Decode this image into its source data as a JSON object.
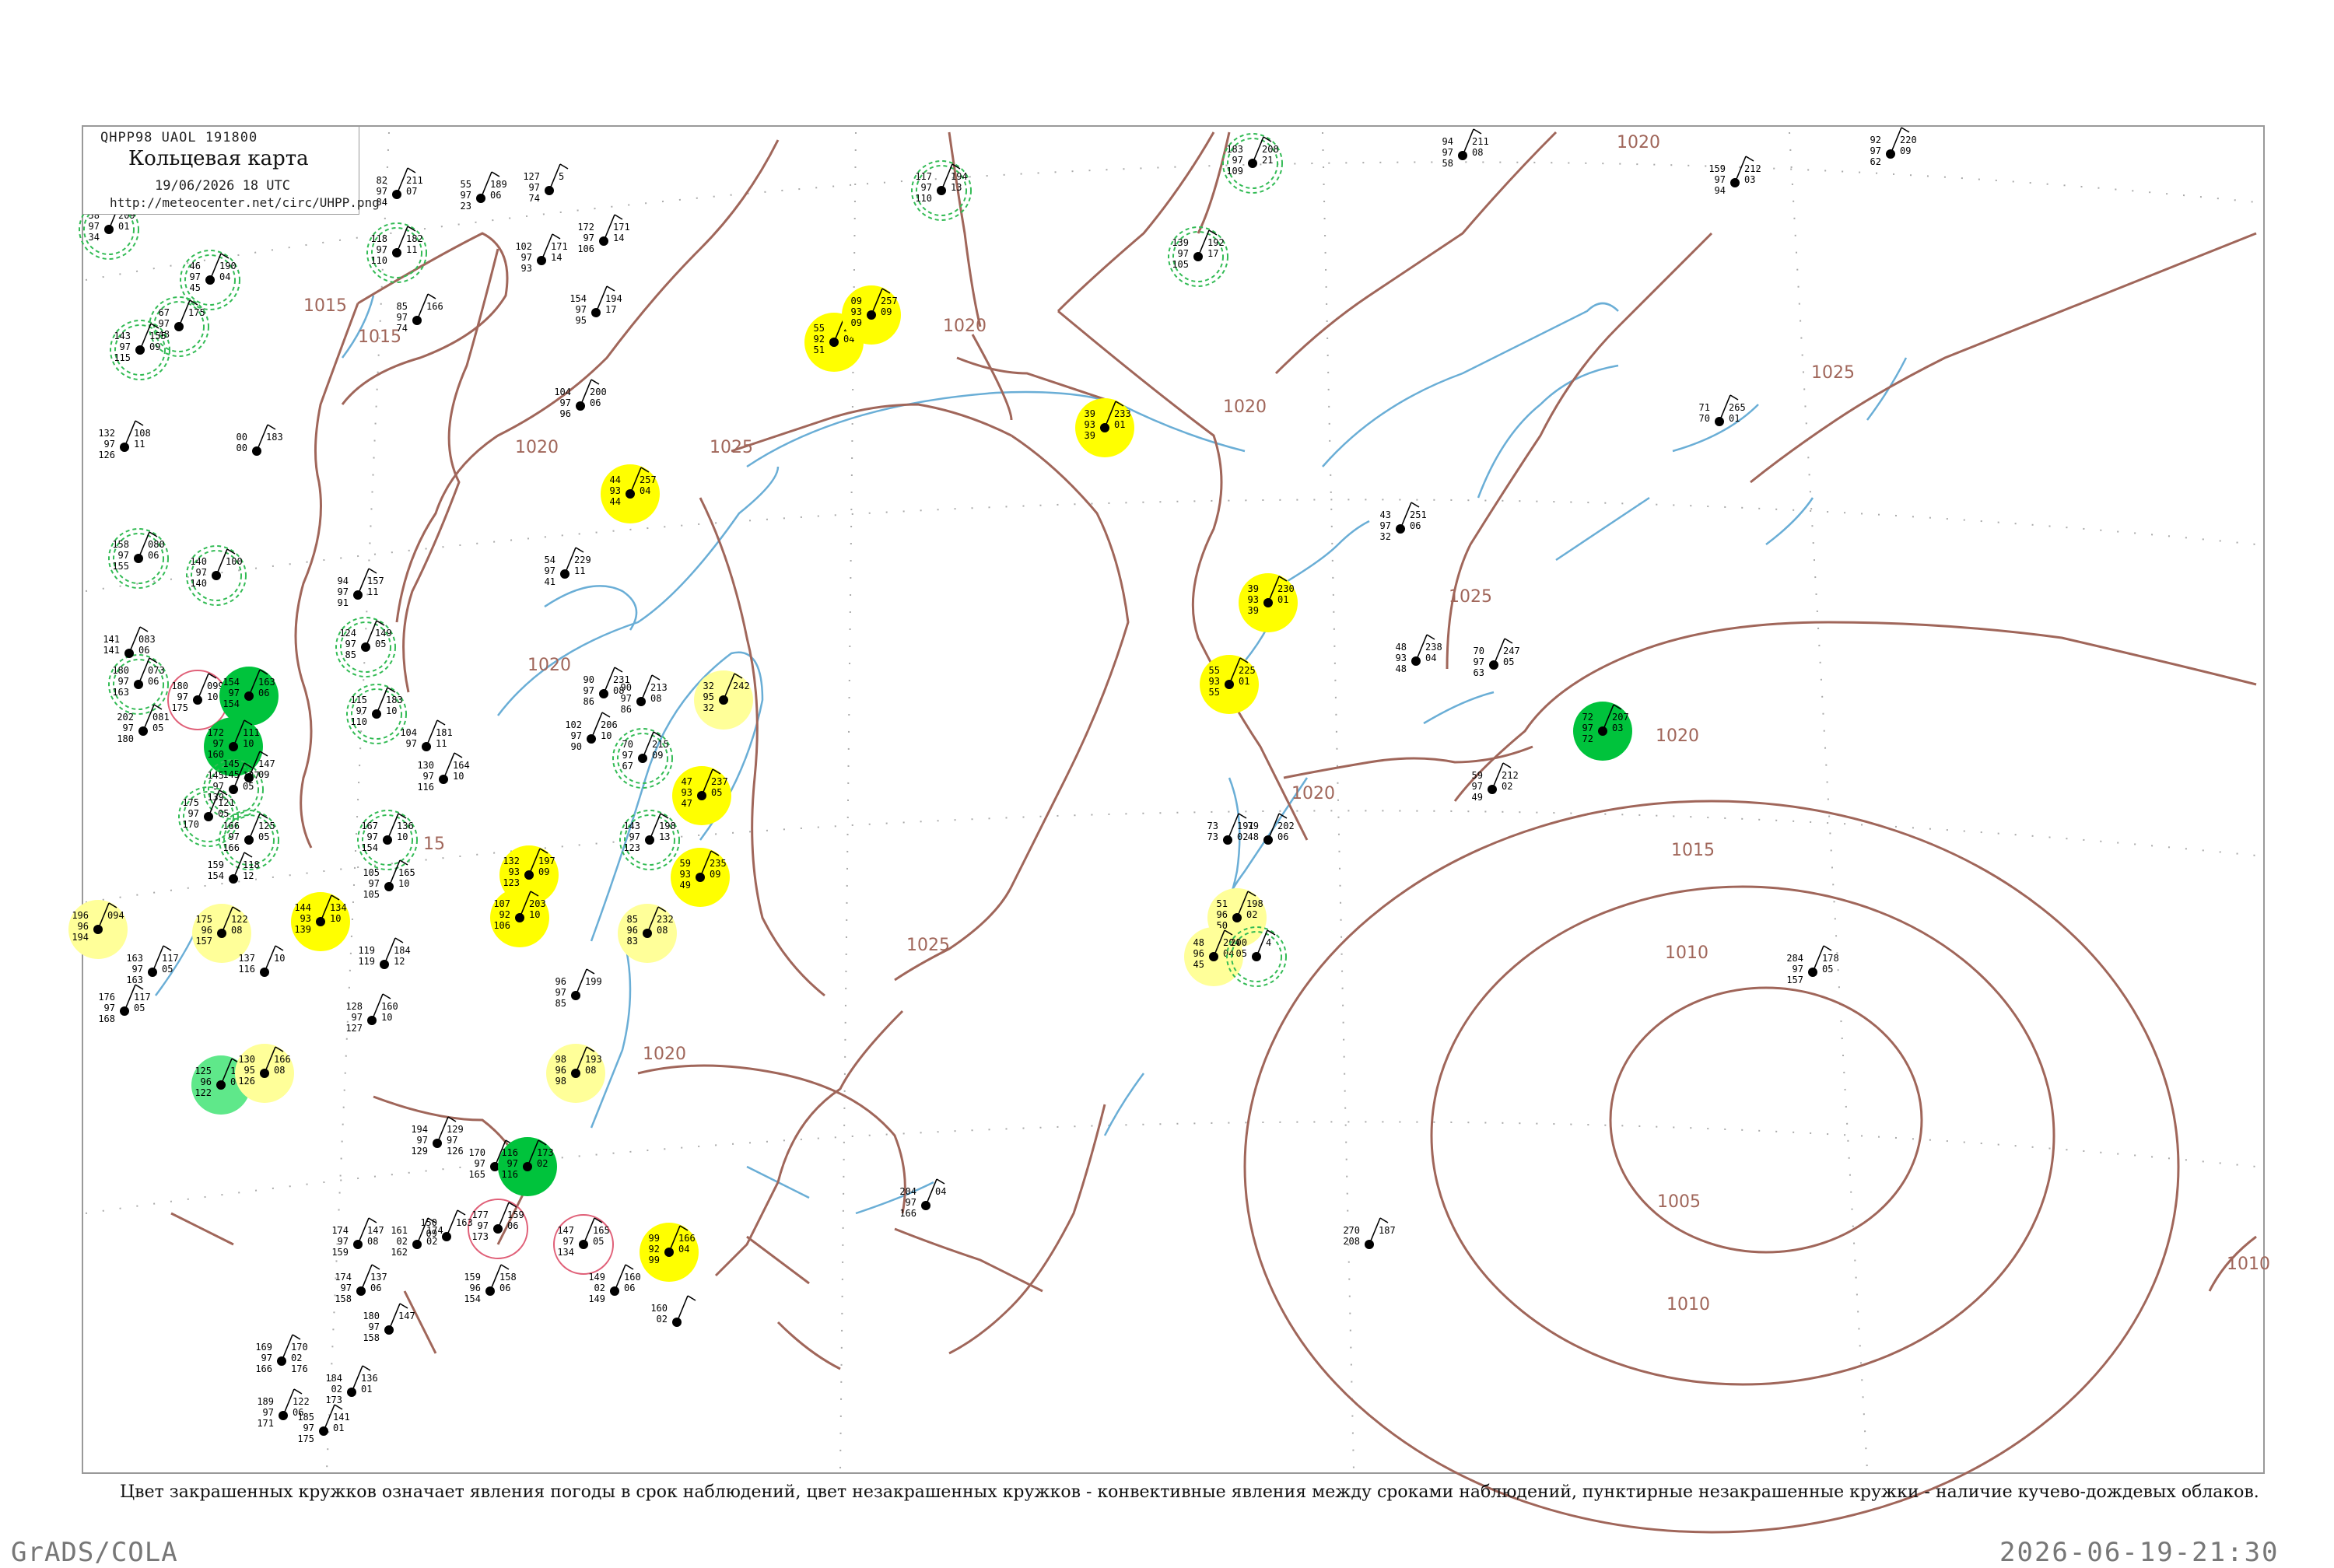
{
  "header": {
    "code": "QHPP98  UAOL  191800",
    "name": "Кольцевая карта",
    "time": "19/06/2026 18 UTC",
    "url": "http://meteocenter.net/circ/UHPP.png"
  },
  "caption": "Цвет закрашенных кружков означает явления погоды в срок наблюдений, цвет незакрашенных кружков - конвективные явления между сроками наблюдений, пунктирные незакрашенные кружки - наличие кучево-дождевых облаков.",
  "footer": {
    "left": "GrADS/COLA",
    "right": "2026-06-19-21:30"
  },
  "colors": {
    "isobar": "#a0665a",
    "water": "#6aaed6",
    "yellow": "#ffff00",
    "light_yellow": "#ffff99",
    "green": "#00c33c",
    "light_green": "#5fe88a",
    "red": "#f03c5a",
    "dashed_green": "#33bb55",
    "outline_red": "#e06078"
  },
  "isobar_labels": [
    {
      "text": "1015"
    },
    {
      "text": "1015"
    },
    {
      "text": "1020"
    },
    {
      "text": "1025"
    },
    {
      "text": "1020"
    },
    {
      "text": "1020"
    },
    {
      "text": "1020"
    },
    {
      "text": "1025"
    },
    {
      "text": "1025"
    },
    {
      "text": "1020"
    },
    {
      "text": "1020"
    },
    {
      "text": "1015"
    },
    {
      "text": "1010"
    },
    {
      "text": "1005"
    },
    {
      "text": "1010"
    },
    {
      "text": "1020"
    },
    {
      "text": "1020"
    },
    {
      "text": "1025"
    },
    {
      "text": "15"
    },
    {
      "text": "1010"
    }
  ],
  "stations": [
    {
      "lines": [
        "82",
        "97",
        "84"
      ],
      "right": [
        "211",
        "07"
      ]
    },
    {
      "lines": [
        "118",
        "97",
        "110"
      ],
      "right": [
        "182",
        "11"
      ]
    },
    {
      "lines": [
        "55",
        "97",
        "23"
      ],
      "right": [
        "189",
        "06"
      ]
    },
    {
      "lines": [
        "127",
        "97",
        "74"
      ],
      "right": [
        "5"
      ]
    },
    {
      "lines": [
        "102",
        "97",
        "93"
      ],
      "right": [
        "171",
        "14"
      ]
    },
    {
      "lines": [
        "172",
        "97",
        "106"
      ],
      "right": [
        "171",
        "14"
      ]
    },
    {
      "lines": [
        "154",
        "97",
        "95"
      ],
      "right": [
        "194",
        "17"
      ]
    },
    {
      "lines": [
        "104",
        "97",
        "96"
      ],
      "right": [
        "200",
        "06"
      ]
    },
    {
      "lines": [
        "85",
        "97",
        "74"
      ],
      "right": [
        "166"
      ]
    },
    {
      "lines": [
        "117",
        "97",
        "110"
      ],
      "right": [
        "194",
        "13"
      ]
    },
    {
      "lines": [
        "183",
        "97",
        "109"
      ],
      "right": [
        "208",
        "21"
      ]
    },
    {
      "lines": [
        "139",
        "97",
        "105"
      ],
      "right": [
        "192",
        "17"
      ]
    },
    {
      "lines": [
        "94",
        "97",
        "58"
      ],
      "right": [
        "211",
        "08"
      ]
    },
    {
      "lines": [
        "159",
        "97",
        "94"
      ],
      "right": [
        "212",
        "03"
      ]
    },
    {
      "lines": [
        "92",
        "97",
        "62"
      ],
      "right": [
        "220",
        "09"
      ]
    },
    {
      "lines": [
        "58",
        "97",
        "34"
      ],
      "right": [
        "209",
        "01"
      ]
    },
    {
      "lines": [
        "46",
        "97",
        "45"
      ],
      "right": [
        "190",
        "04"
      ]
    },
    {
      "lines": [
        "67",
        "97",
        "48"
      ],
      "right": [
        "175"
      ]
    },
    {
      "lines": [
        "143",
        "97",
        "115"
      ],
      "right": [
        "155",
        "09"
      ]
    },
    {
      "lines": [
        "132",
        "97",
        "126"
      ],
      "right": [
        "108",
        "11"
      ]
    },
    {
      "lines": [
        "158",
        "97",
        "155"
      ],
      "right": [
        "080",
        "06"
      ]
    },
    {
      "lines": [
        "140",
        "97",
        "140"
      ],
      "right": [
        "100"
      ]
    },
    {
      "lines": [
        "94",
        "97",
        "91"
      ],
      "right": [
        "157",
        "11"
      ]
    },
    {
      "lines": [
        "124",
        "97",
        "85"
      ],
      "right": [
        "149",
        "05"
      ]
    },
    {
      "lines": [
        "54",
        "97",
        "41"
      ],
      "right": [
        "229",
        "11"
      ]
    },
    {
      "lines": [
        "43",
        "97",
        "32"
      ],
      "right": [
        "251",
        "06"
      ]
    },
    {
      "lines": [
        "71",
        "70"
      ],
      "right": [
        "265",
        "01"
      ]
    },
    {
      "lines": [
        "39",
        "93",
        "39"
      ],
      "right": [
        "233",
        "01"
      ]
    },
    {
      "lines": [
        "44",
        "93",
        "44"
      ],
      "right": [
        "257",
        "04"
      ]
    },
    {
      "lines": [
        "55",
        "92",
        "51"
      ],
      "right": [
        "244",
        "04"
      ]
    },
    {
      "lines": [
        "09",
        "93",
        "09"
      ],
      "right": [
        "257",
        "09"
      ]
    },
    {
      "lines": [
        "39",
        "93",
        "39"
      ],
      "right": [
        "230",
        "01"
      ]
    },
    {
      "lines": [
        "55",
        "93",
        "55"
      ],
      "right": [
        "225",
        "01"
      ]
    },
    {
      "lines": [
        "48",
        "93",
        "48"
      ],
      "right": [
        "238",
        "04"
      ]
    },
    {
      "lines": [
        "70",
        "97",
        "63"
      ],
      "right": [
        "247",
        "05"
      ]
    },
    {
      "lines": [
        "59",
        "97",
        "49"
      ],
      "right": [
        "212",
        "02"
      ]
    },
    {
      "lines": [
        "72",
        "97",
        "72"
      ],
      "right": [
        "207",
        "03"
      ]
    },
    {
      "lines": [
        "180",
        "97",
        "163"
      ],
      "right": [
        "073",
        "06"
      ]
    },
    {
      "lines": [
        "180",
        "97",
        "175"
      ],
      "right": [
        "099",
        "10"
      ]
    },
    {
      "lines": [
        "154",
        "97",
        "154"
      ],
      "right": [
        "163",
        "06"
      ]
    },
    {
      "lines": [
        "202",
        "97",
        "180"
      ],
      "right": [
        "081",
        "05"
      ]
    },
    {
      "lines": [
        "172",
        "97",
        "160"
      ],
      "right": [
        "111",
        "10"
      ]
    },
    {
      "lines": [
        "115",
        "97",
        "110"
      ],
      "right": [
        "183",
        "10"
      ]
    },
    {
      "lines": [
        "90",
        "97",
        "86"
      ],
      "right": [
        "231",
        "08"
      ]
    },
    {
      "lines": [
        "90",
        "97",
        "86"
      ],
      "right": [
        "213",
        "08"
      ]
    },
    {
      "lines": [
        "104",
        "97",
        ""
      ],
      "right": [
        "181",
        "11"
      ]
    },
    {
      "lines": [
        "130",
        "97",
        "116"
      ],
      "right": [
        "164",
        "10"
      ]
    },
    {
      "lines": [
        "102",
        "97",
        "90"
      ],
      "right": [
        "206",
        "10"
      ]
    },
    {
      "lines": [
        "70",
        "97",
        "67"
      ],
      "right": [
        "215",
        "09"
      ]
    },
    {
      "lines": [
        "32",
        "95",
        "32"
      ],
      "right": [
        "242"
      ]
    },
    {
      "lines": [
        "47",
        "93",
        "47"
      ],
      "right": [
        "237",
        "05"
      ]
    },
    {
      "lines": [
        "145",
        "97",
        "139"
      ],
      "right": [
        "127",
        "05"
      ]
    },
    {
      "lines": [
        "175",
        "97",
        "170"
      ],
      "right": [
        "121",
        "05"
      ]
    },
    {
      "lines": [
        "166",
        "97",
        "166"
      ],
      "right": [
        "125",
        "05"
      ]
    },
    {
      "lines": [
        "167",
        "97",
        "154"
      ],
      "right": [
        "136",
        "10"
      ]
    },
    {
      "lines": [
        "105",
        "97",
        "105"
      ],
      "right": [
        "165",
        "10"
      ]
    },
    {
      "lines": [
        "143",
        "97",
        "123"
      ],
      "right": [
        "198",
        "13"
      ]
    },
    {
      "lines": [
        "132",
        "93",
        "123"
      ],
      "right": [
        "197",
        "09"
      ]
    },
    {
      "lines": [
        "107",
        "92",
        "106"
      ],
      "right": [
        "203",
        "10"
      ]
    },
    {
      "lines": [
        "59",
        "93",
        "49"
      ],
      "right": [
        "235",
        "09"
      ]
    },
    {
      "lines": [
        "196",
        "96",
        "194"
      ],
      "right": [
        "094"
      ]
    },
    {
      "lines": [
        "175",
        "96",
        "157"
      ],
      "right": [
        "122",
        "08"
      ]
    },
    {
      "lines": [
        "144",
        "93",
        "139"
      ],
      "right": [
        "134",
        "10"
      ]
    },
    {
      "lines": [
        "163",
        "97",
        "163"
      ],
      "right": [
        "117",
        "05"
      ]
    },
    {
      "lines": [
        "176",
        "97",
        "168"
      ],
      "right": [
        "117",
        "05"
      ]
    },
    {
      "lines": [
        "137",
        "116"
      ],
      "right": [
        "10"
      ]
    },
    {
      "lines": [
        "128",
        "97",
        "127"
      ],
      "right": [
        "160",
        "10"
      ]
    },
    {
      "lines": [
        "119",
        "119"
      ],
      "right": [
        "184",
        "12"
      ]
    },
    {
      "lines": [
        "96",
        "97",
        "85"
      ],
      "right": [
        "199"
      ]
    },
    {
      "lines": [
        "85",
        "96",
        "83"
      ],
      "right": [
        "232",
        "08"
      ]
    },
    {
      "lines": [
        "98",
        "96",
        "98"
      ],
      "right": [
        "193",
        "08"
      ]
    },
    {
      "lines": [
        "51",
        "96",
        "50"
      ],
      "right": [
        "198",
        "02"
      ]
    },
    {
      "lines": [
        "48",
        "96",
        "45"
      ],
      "right": [
        "204",
        "04"
      ]
    },
    {
      "lines": [
        "200",
        "05"
      ],
      "right": [
        "4"
      ]
    },
    {
      "lines": [
        "73",
        "73"
      ],
      "right": [
        "191",
        "02"
      ]
    },
    {
      "lines": [
        "79",
        "48"
      ],
      "right": [
        "202",
        "06"
      ]
    },
    {
      "lines": [
        "284",
        "97",
        "157"
      ],
      "right": [
        "178",
        "05"
      ]
    },
    {
      "lines": [
        "125",
        "96",
        "122"
      ],
      "right": [
        "150",
        "04"
      ]
    },
    {
      "lines": [
        "130",
        "95",
        "126"
      ],
      "right": [
        "166",
        "08"
      ]
    },
    {
      "lines": [
        "194",
        "97",
        "129"
      ],
      "right": [
        "129",
        "97",
        "126"
      ]
    },
    {
      "lines": [
        "170",
        "97",
        "165"
      ],
      "right": [
        "156",
        "08"
      ]
    },
    {
      "lines": [
        "116",
        "97",
        "116"
      ],
      "right": [
        "173",
        "02"
      ]
    },
    {
      "lines": [
        "177",
        "97",
        "173"
      ],
      "right": [
        "159",
        "06"
      ]
    },
    {
      "lines": [
        "147",
        "97",
        "134"
      ],
      "right": [
        "165",
        "05"
      ]
    },
    {
      "lines": [
        "99",
        "92",
        "99"
      ],
      "right": [
        "166",
        "04"
      ]
    },
    {
      "lines": [
        "204",
        "97",
        "166"
      ],
      "right": [
        "04"
      ]
    },
    {
      "lines": [
        "270",
        "208"
      ],
      "right": [
        "187"
      ]
    },
    {
      "lines": [
        "174",
        "97",
        "159"
      ],
      "right": [
        "147",
        "08"
      ]
    },
    {
      "lines": [
        "174",
        "97",
        "158"
      ],
      "right": [
        "137",
        "06"
      ]
    },
    {
      "lines": [
        "180",
        "97",
        "158"
      ],
      "right": [
        "147"
      ]
    },
    {
      "lines": [
        "161",
        "02",
        "162"
      ],
      "right": [
        "174",
        "02"
      ]
    },
    {
      "lines": [
        "150",
        "09"
      ],
      "right": [
        "163"
      ]
    },
    {
      "lines": [
        "159",
        "96",
        "154"
      ],
      "right": [
        "158",
        "06"
      ]
    },
    {
      "lines": [
        "149",
        "02",
        "149"
      ],
      "right": [
        "160",
        "06"
      ]
    },
    {
      "lines": [
        "160",
        "02"
      ],
      "right": [
        ""
      ]
    },
    {
      "lines": [
        "169",
        "97",
        "166"
      ],
      "right": [
        "170",
        "02",
        "176"
      ]
    },
    {
      "lines": [
        "189",
        "97",
        "171"
      ],
      "right": [
        "122",
        "06"
      ]
    },
    {
      "lines": [
        "184",
        "02",
        "173"
      ],
      "right": [
        "136",
        "01"
      ]
    },
    {
      "lines": [
        "185",
        "97",
        "175"
      ],
      "right": [
        "141",
        "01"
      ]
    },
    {
      "lines": [
        "141",
        "141"
      ],
      "right": [
        "083",
        "06"
      ]
    },
    {
      "lines": [
        "145",
        "145"
      ],
      "right": [
        "147",
        "09"
      ]
    },
    {
      "lines": [
        "159",
        "154"
      ],
      "right": [
        "118",
        "12"
      ]
    },
    {
      "lines": [
        "00",
        "00"
      ],
      "right": [
        "183"
      ]
    }
  ]
}
